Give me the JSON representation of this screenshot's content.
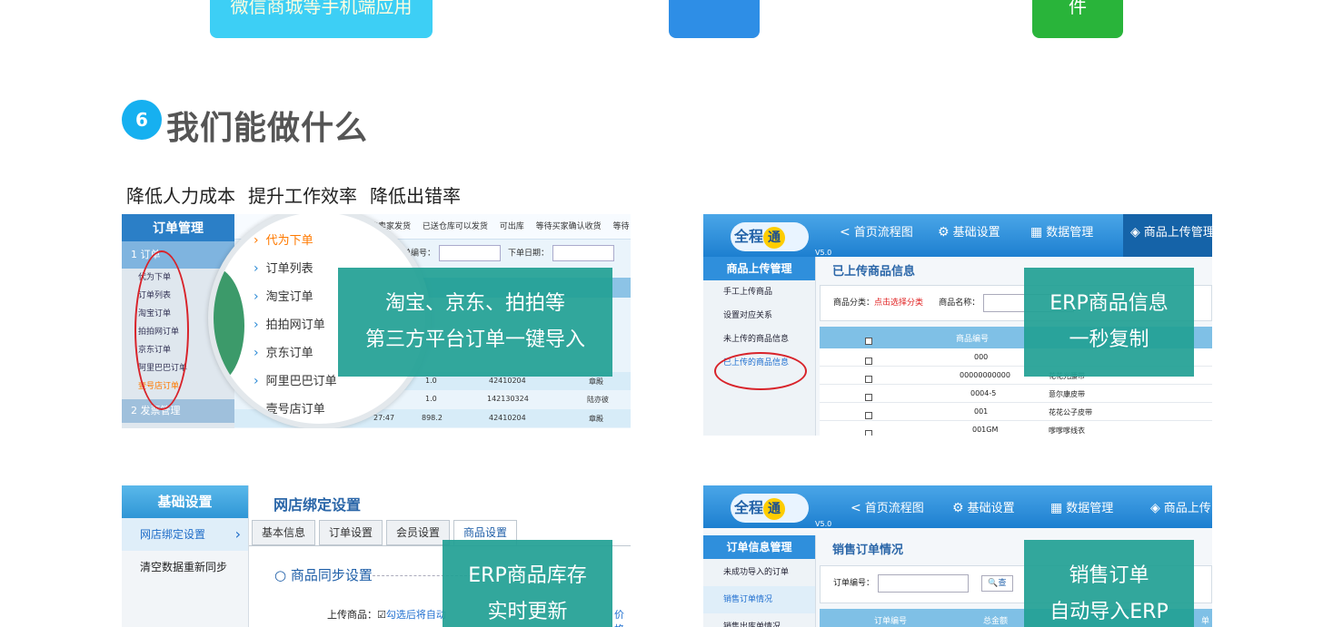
{
  "top_pills": {
    "cyan_text": "微信商城等手机端应用",
    "blue_text": "",
    "green_text": "件"
  },
  "section": {
    "number": "6",
    "title": "我们能做什么",
    "benefits": [
      "降低人力成本",
      "提升工作效率",
      "降低出错率"
    ]
  },
  "panel1": {
    "sidebar_title": "订单管理",
    "group1": "1 订单",
    "items": [
      "代为下单",
      "订单列表",
      "淘宝订单",
      "拍拍网订单",
      "京东订单",
      "阿里巴巴订单",
      "壹号店订单"
    ],
    "group2": "2 发票管理",
    "tabs_text": "等待卖家发货  已送仓库可以发货  可出库  等待买家确认收货  等待",
    "filter_order": "订单编号：",
    "filter_date": "下单日期：",
    "magnifier_items": [
      "代为下单",
      "订单列表",
      "淘宝订单",
      "拍拍网订单",
      "京东订单",
      "阿里巴巴订单",
      "壹号店订单"
    ],
    "rows": [
      {
        "qty": "1.0",
        "code": "42410204",
        "name": "章殿"
      },
      {
        "qty": "1.0",
        "code": "142130324",
        "name": "陆亦彼"
      },
      {
        "time": "27:47",
        "qty": "898.2",
        "code": "42410204",
        "name": "章殿"
      }
    ],
    "overlay": [
      "淘宝、京东、拍拍等",
      "第三方平台订单一键导入"
    ]
  },
  "panel2": {
    "logo": "全程",
    "logo_badge": "通",
    "version": "V5.0",
    "nav": [
      "首页流程图",
      "基础设置",
      "数据管理",
      "商品上传管理"
    ],
    "sidebar_title": "商品上传管理",
    "sidebar_items": [
      "手工上传商品",
      "设置对应关系",
      "未上传的商品信息",
      "已上传的商品信息"
    ],
    "page_title": "已上传商品信息",
    "filter_label": "商品分类：",
    "filter_link": "点击选择分类",
    "filter_name": "商品名称：",
    "table_headers": [
      "商品编号"
    ],
    "rows": [
      {
        "code": "000",
        "name": ""
      },
      {
        "code": "00000000000",
        "name": "花花光腰带"
      },
      {
        "code": "0004-5",
        "name": "意尔康皮带"
      },
      {
        "code": "001",
        "name": "花花公子皮带"
      },
      {
        "code": "001GM",
        "name": "嗲嗲嗲线衣"
      }
    ],
    "overlay": [
      "ERP商品信息",
      "一秒复制"
    ]
  },
  "panel3": {
    "sidebar_title": "基础设置",
    "sidebar_items": [
      "网店绑定设置",
      "清空数据重新同步"
    ],
    "page_title": "网店绑定设置",
    "tabs": [
      "基本信息",
      "订单设置",
      "会员设置",
      "商品设置"
    ],
    "sync_title": "商品同步设置",
    "upload_label": "上传商品：",
    "upload_hint": "勾选后将自动",
    "price_text": "价格",
    "overlay": [
      "ERP商品库存",
      "实时更新"
    ]
  },
  "panel4": {
    "logo": "全程",
    "logo_badge": "通",
    "version": "V5.0",
    "nav": [
      "首页流程图",
      "基础设置",
      "数据管理",
      "商品上传"
    ],
    "sidebar_title": "订单信息管理",
    "sidebar_items": [
      "未成功导入的订单",
      "销售订单情况",
      "销售出库单情况"
    ],
    "page_title": "销售订单情况",
    "filter_label": "订单编号：",
    "search_label": "查",
    "table_headers": [
      "订单编号",
      "总金额",
      "单状"
    ],
    "overlay": [
      "销售订单",
      "自动导入ERP"
    ]
  },
  "colors": {
    "accent_cyan": "#3dcff5",
    "accent_blue": "#2e8ee6",
    "accent_green": "#29b43a",
    "overlay_teal": "#22a094",
    "number_badge": "#16b0f0"
  }
}
